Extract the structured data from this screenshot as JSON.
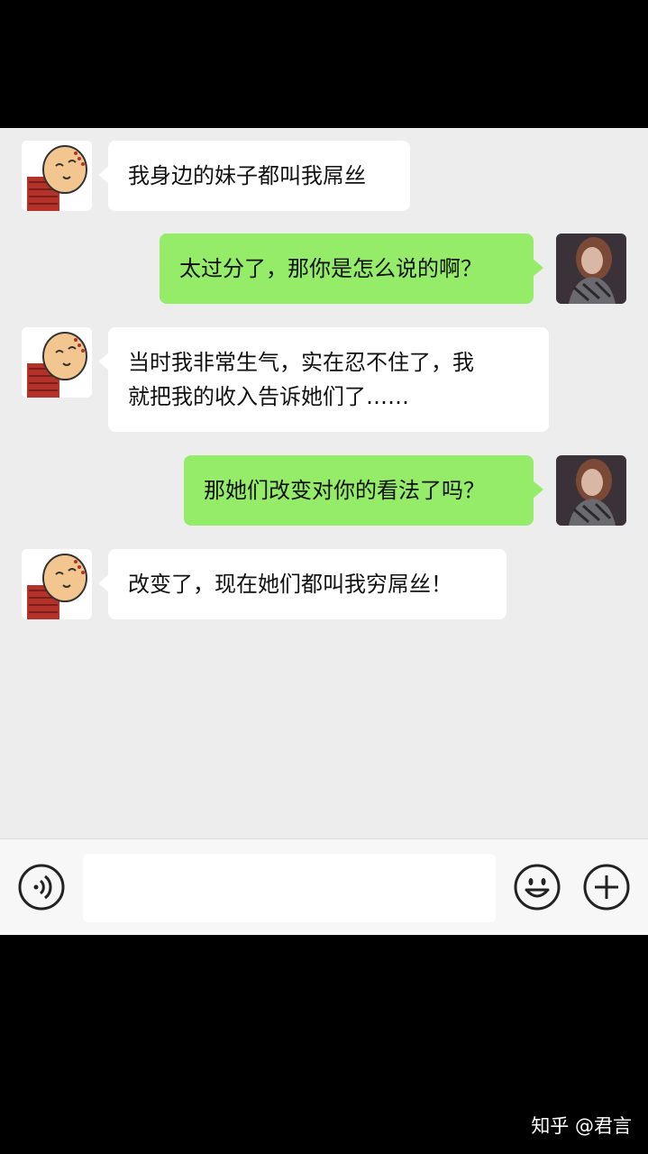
{
  "messages": [
    {
      "side": "in",
      "text": "我身边的妹子都叫我屌丝"
    },
    {
      "side": "out",
      "text": "太过分了，那你是怎么说的啊？"
    },
    {
      "side": "in",
      "text": "当时我非常生气，实在忍不住了，我\n就把我的收入告诉她们了……"
    },
    {
      "side": "out",
      "text": "那她们改变对你的看法了吗？"
    },
    {
      "side": "in",
      "text": "改变了，现在她们都叫我穷屌丝！"
    }
  ],
  "input_bar": {
    "voice_icon": "voice-icon",
    "emoji_icon": "emoji-icon",
    "plus_icon": "plus-icon",
    "input_value": ""
  },
  "watermark": "知乎 @君言",
  "colors": {
    "outgoing_bubble": "#95ec69",
    "incoming_bubble": "#ffffff",
    "chat_bg": "#ededed"
  }
}
